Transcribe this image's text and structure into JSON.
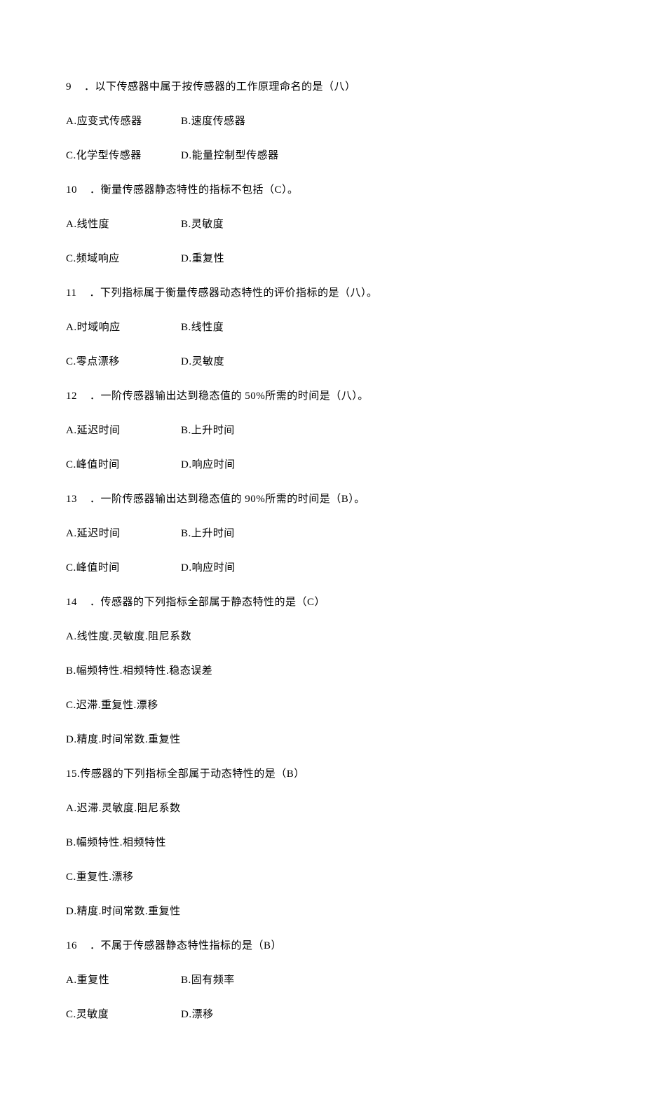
{
  "questions": [
    {
      "num": "9",
      "dot": "．",
      "stem": "以下传感器中属于按传感器的工作原理命名的是（八）",
      "opts": [
        {
          "a": "A.应变式传感器",
          "b": "B.速度传感器"
        },
        {
          "a": "C.化学型传感器",
          "b": "D.能量控制型传感器"
        }
      ]
    },
    {
      "num": "10",
      "dot": "．",
      "stem": "衡量传感器静态特性的指标不包括（C）。",
      "opts": [
        {
          "a": "A.线性度",
          "b": "B.灵敏度"
        },
        {
          "a": "C.频域响应",
          "b": "D.重复性"
        }
      ]
    },
    {
      "num": "11",
      "dot": "．",
      "stem": "下列指标属于衡量传感器动态特性的评价指标的是（八）。",
      "opts": [
        {
          "a": "A.时域响应",
          "b": "B.线性度"
        },
        {
          "a": "C.零点漂移",
          "b": "D.灵敏度"
        }
      ]
    },
    {
      "num": "12",
      "dot": "．",
      "stem": "一阶传感器输出达到稳态值的 50%所需的时间是（八）。",
      "opts": [
        {
          "a": "A.延迟时间",
          "b": "B.上升时间"
        },
        {
          "a": "C.峰值时间",
          "b": "D.响应时间"
        }
      ]
    },
    {
      "num": "13",
      "dot": "．",
      "stem": "一阶传感器输出达到稳态值的 90%所需的时间是（B）。",
      "opts": [
        {
          "a": "A.延迟时间",
          "b": "B.上升时间"
        },
        {
          "a": "C.峰值时间",
          "b": "D.响应时间"
        }
      ]
    },
    {
      "num": "14",
      "dot": "．",
      "stem": "传感器的下列指标全部属于静态特性的是（C）",
      "single_opts": [
        "A.线性度.灵敏度.阻尼系数",
        "B.幅频特性.相频特性.稳态误差",
        "C.迟滞.重复性.漂移",
        "D.精度.时间常数.重复性"
      ]
    },
    {
      "num_stem": "15.传感器的下列指标全部属于动态特性的是（B）",
      "single_opts": [
        "A.迟滞.灵敏度.阻尼系数",
        "B.幅频特性.相频特性",
        "C.重复性.漂移",
        "D.精度.时间常数.重复性"
      ]
    },
    {
      "num": "16",
      "dot": "．",
      "stem": "不属于传感器静态特性指标的是（B）",
      "opts": [
        {
          "a": "A.重复性",
          "b": "B.固有频率"
        },
        {
          "a": "C.灵敏度",
          "b": "D.漂移"
        }
      ]
    }
  ]
}
